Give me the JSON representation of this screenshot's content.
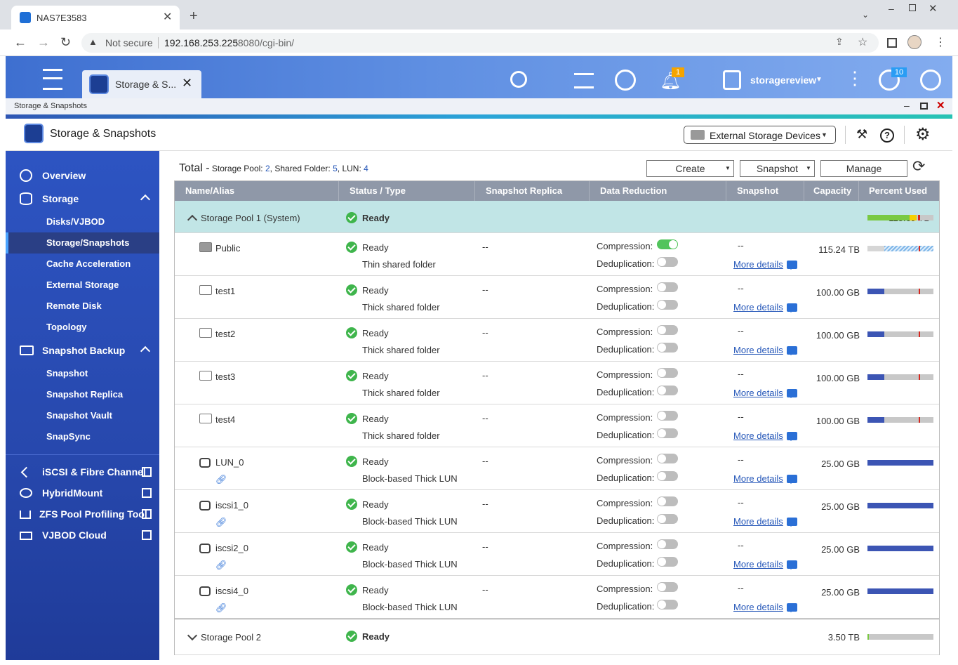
{
  "browser": {
    "tab_title": "NAS7E3583",
    "security": "Not secure",
    "url_host": "192.168.253.225",
    "url_rest": ":8080/cgi-bin/"
  },
  "qts": {
    "app_tab": "Storage & S...",
    "user": "storagereview",
    "notif_count": "1",
    "info_count": "10"
  },
  "window": {
    "title": "Storage & Snapshots"
  },
  "app": {
    "title": "Storage & Snapshots",
    "device_select": "External Storage Devices"
  },
  "sidebar": {
    "overview": "Overview",
    "storage": "Storage",
    "storage_items": [
      "Disks/VJBOD",
      "Storage/Snapshots",
      "Cache Acceleration",
      "External Storage",
      "Remote Disk",
      "Topology"
    ],
    "snapshot_backup": "Snapshot Backup",
    "snapshot_items": [
      "Snapshot",
      "Snapshot Replica",
      "Snapshot Vault",
      "SnapSync"
    ],
    "links": [
      "iSCSI & Fibre Channel",
      "HybridMount",
      "ZFS Pool Profiling Tool",
      "VJBOD Cloud"
    ]
  },
  "summary": {
    "label": "Total -",
    "pool_label": "Storage Pool:",
    "pool_count": "2",
    "folder_label": "Shared Folder:",
    "folder_count": "5",
    "lun_label": "LUN:",
    "lun_count": "4"
  },
  "buttons": {
    "create": "Create",
    "snapshot": "Snapshot",
    "manage": "Manage"
  },
  "columns": [
    "Name/Alias",
    "Status / Type",
    "Snapshot Replica",
    "Data Reduction",
    "Snapshot",
    "Capacity",
    "Percent Used"
  ],
  "labels": {
    "compression": "Compression:",
    "deduplication": "Deduplication:",
    "more_details": "More details",
    "dash": "--"
  },
  "pool1": {
    "name": "Storage Pool 1 (System)",
    "status": "Ready",
    "capacity": "115.69 TB"
  },
  "rows": [
    {
      "name": "Public",
      "status": "Ready",
      "type": "Thin shared folder",
      "replica": "--",
      "snapshot": "--",
      "capacity": "115.24 TB",
      "kind": "folder-open",
      "compression": true,
      "used": 1.0
    },
    {
      "name": "test1",
      "status": "Ready",
      "type": "Thick shared folder",
      "replica": "--",
      "snapshot": "--",
      "capacity": "100.00 GB",
      "kind": "folder",
      "compression": false,
      "used": 0.25
    },
    {
      "name": "test2",
      "status": "Ready",
      "type": "Thick shared folder",
      "replica": "--",
      "snapshot": "--",
      "capacity": "100.00 GB",
      "kind": "folder",
      "compression": false,
      "used": 0.25
    },
    {
      "name": "test3",
      "status": "Ready",
      "type": "Thick shared folder",
      "replica": "--",
      "snapshot": "--",
      "capacity": "100.00 GB",
      "kind": "folder",
      "compression": false,
      "used": 0.25
    },
    {
      "name": "test4",
      "status": "Ready",
      "type": "Thick shared folder",
      "replica": "--",
      "snapshot": "--",
      "capacity": "100.00 GB",
      "kind": "folder",
      "compression": false,
      "used": 0.25
    },
    {
      "name": "LUN_0",
      "status": "Ready",
      "type": "Block-based Thick LUN",
      "replica": "--",
      "snapshot": "--",
      "capacity": "25.00 GB",
      "kind": "lun",
      "compression": false,
      "used": 1.0
    },
    {
      "name": "iscsi1_0",
      "status": "Ready",
      "type": "Block-based Thick LUN",
      "replica": "--",
      "snapshot": "--",
      "capacity": "25.00 GB",
      "kind": "lun",
      "compression": false,
      "used": 1.0
    },
    {
      "name": "iscsi2_0",
      "status": "Ready",
      "type": "Block-based Thick LUN",
      "replica": "--",
      "snapshot": "--",
      "capacity": "25.00 GB",
      "kind": "lun",
      "compression": false,
      "used": 1.0
    },
    {
      "name": "iscsi4_0",
      "status": "Ready",
      "type": "Block-based Thick LUN",
      "replica": "--",
      "snapshot": "--",
      "capacity": "25.00 GB",
      "kind": "lun",
      "compression": false,
      "used": 1.0
    }
  ],
  "pool2": {
    "name": "Storage Pool 2",
    "status": "Ready",
    "capacity": "3.50 TB"
  },
  "colors": {
    "accent": "#2d54c2",
    "ready": "#3fb54c",
    "bar_blue": "#3c55b4",
    "link": "#2456b8"
  }
}
